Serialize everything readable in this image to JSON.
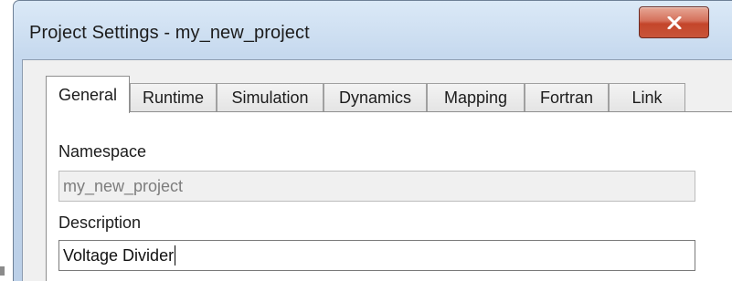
{
  "window": {
    "title": "Project Settings - my_new_project",
    "close_icon": "close-icon"
  },
  "tabs": [
    {
      "label": "General",
      "active": true
    },
    {
      "label": "Runtime",
      "active": false
    },
    {
      "label": "Simulation",
      "active": false
    },
    {
      "label": "Dynamics",
      "active": false
    },
    {
      "label": "Mapping",
      "active": false
    },
    {
      "label": "Fortran",
      "active": false
    },
    {
      "label": "Link",
      "active": false
    }
  ],
  "general": {
    "namespace_label": "Namespace",
    "namespace_value": "my_new_project",
    "description_label": "Description",
    "description_value": "Voltage Divider"
  },
  "colors": {
    "close_button": "#c4452a",
    "titlebar": "#c6d9ee"
  }
}
